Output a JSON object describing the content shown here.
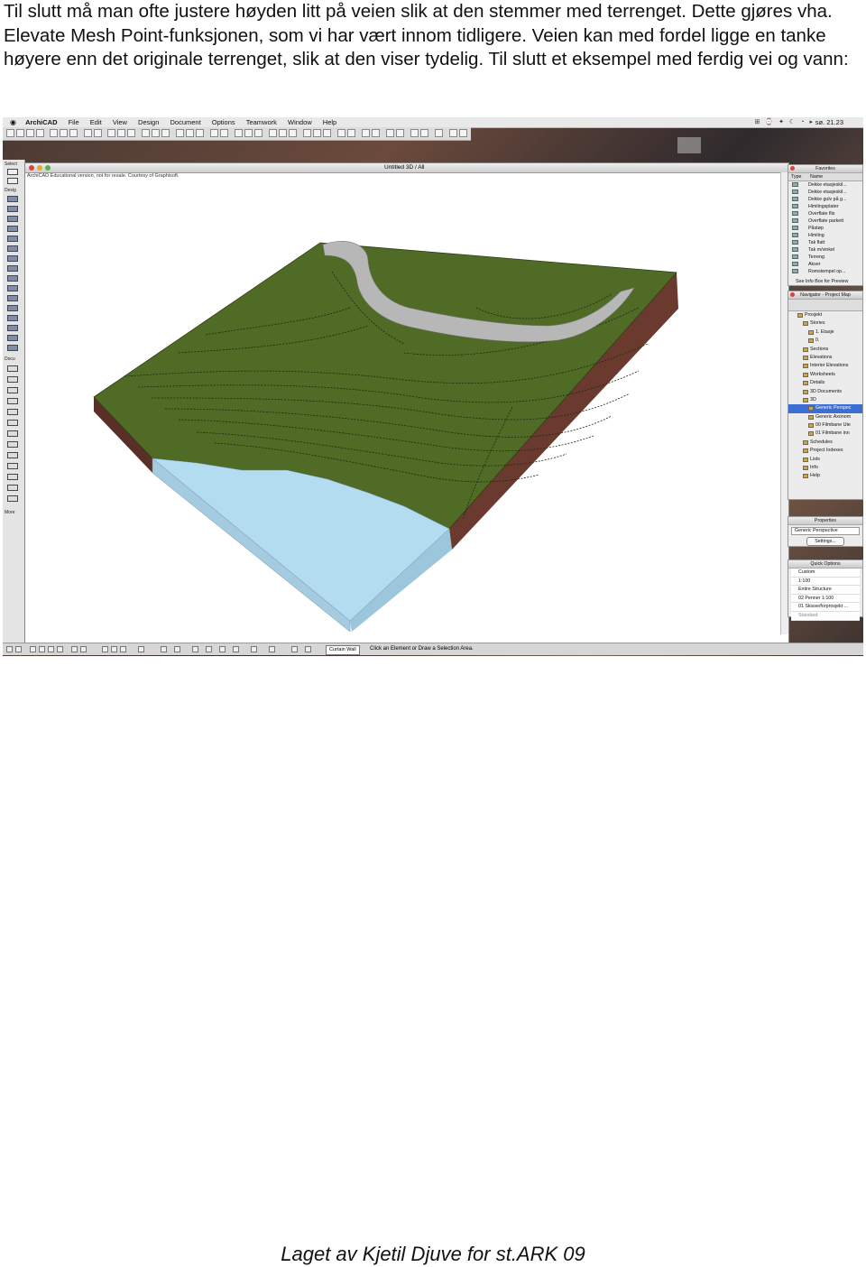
{
  "intro_text": "Til slutt må man ofte justere høyden litt på veien slik at den stemmer med terrenget. Dette gjøres vha. Elevate Mesh Point-funksjonen, som vi har vært innom tidligere. Veien kan med fordel ligge en tanke høyere enn det originale terrenget, slik at den viser tydelig. Til slutt et eksempel med ferdig vei og vann:",
  "footer_text": "Laget av Kjetil Djuve for st.ARK 09",
  "menubar": {
    "app": "ArchiCAD",
    "items": [
      "File",
      "Edit",
      "View",
      "Design",
      "Document",
      "Options",
      "Teamwork",
      "Window",
      "Help"
    ],
    "clock": "sø. 21.23"
  },
  "window": {
    "title": "Untitled 3D / All",
    "notice": "ArchiCAD Educational version, not for resale. Courtesy of Graphisoft."
  },
  "toolbox": {
    "select_label": "Select",
    "design_label": "Desig",
    "docu_label": "Docu",
    "more_label": "More"
  },
  "favorites": {
    "title": "Favorites",
    "col_type": "Type",
    "col_name": "Name",
    "items": [
      "Dekke etasjeskil...",
      "Dekke etasjeskil...",
      "Dekke gulv på g...",
      "Himlingsplater",
      "Overflate flis",
      "Overflate parkett",
      "Påstøp",
      "Himling",
      "Tak flatt",
      "Tak m/vinkel",
      "Terreng",
      "Akser",
      "Romstempel op..."
    ],
    "footer": "See Info Box for Preview"
  },
  "navigator": {
    "title": "Navigator - Project Map",
    "tree": [
      "Prosjekt",
      "Stories",
      "1. Etasje",
      "0.",
      "Sections",
      "Elevations",
      "Interior Elevations",
      "Worksheets",
      "Details",
      "3D Documents",
      "3D",
      "Generic Perspec",
      "Generic Axonom",
      "00 Filmbane Ute",
      "01 Filmbane inn",
      "Schedules",
      "Project Indexes",
      "Lists",
      "Info",
      "Help"
    ],
    "selected": "Generic Perspec"
  },
  "properties": {
    "title": "Properties",
    "value": "Generic Perspective",
    "settings_button": "Settings..."
  },
  "quick_options": {
    "title": "Quick Options",
    "rows": [
      "Custom",
      "1:100",
      "Entire Structure",
      "02 Penner 1:100",
      "01 Skisse/forprosjekt ...",
      "Standard"
    ]
  },
  "statusbar": {
    "tool": "Curtain Wall",
    "message": "Click an Element or Draw a Selection Area."
  },
  "colors": {
    "terrain": "#4f6b25",
    "road": "#b7b7b7",
    "water": "#b3dcf0",
    "soil": "#6a3a2e"
  }
}
